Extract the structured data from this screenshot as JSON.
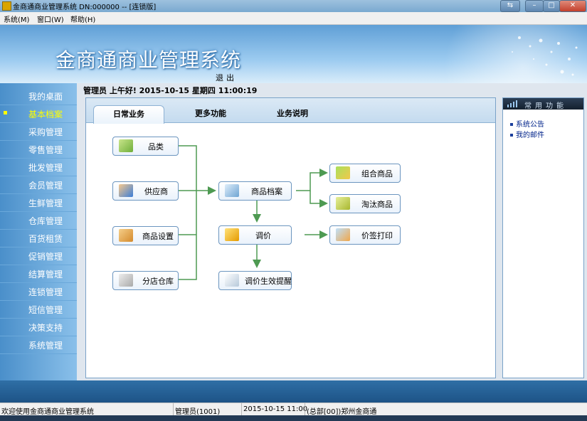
{
  "window": {
    "title": "金商通商业管理系统 DN:000000 -- [连锁版]",
    "controls": [
      "⇆",
      "–",
      "□",
      "✕"
    ]
  },
  "menu": [
    "系统(M)",
    "窗口(W)",
    "帮助(H)"
  ],
  "banner": {
    "app_title": "金商通商业管理系统",
    "logout": "退出"
  },
  "greeting": "管理员 上午好! 2015-10-15 星期四 11:00:19",
  "sidebar": {
    "active_index": 1,
    "items": [
      {
        "label": "我的桌面"
      },
      {
        "label": "基本档案"
      },
      {
        "label": "采购管理"
      },
      {
        "label": "零售管理"
      },
      {
        "label": "批发管理"
      },
      {
        "label": "会员管理"
      },
      {
        "label": "生鲜管理"
      },
      {
        "label": "仓库管理"
      },
      {
        "label": "百货租赁"
      },
      {
        "label": "促销管理"
      },
      {
        "label": "结算管理"
      },
      {
        "label": "连锁管理"
      },
      {
        "label": "短信管理"
      },
      {
        "label": "决策支持"
      },
      {
        "label": "系统管理"
      }
    ]
  },
  "tabs": [
    {
      "label": "日常业务",
      "active": true
    },
    {
      "label": "更多功能",
      "active": false
    },
    {
      "label": "业务说明",
      "active": false
    }
  ],
  "flow": {
    "category": {
      "label": "品类",
      "icon": "category-icon",
      "color": "#8bc34a"
    },
    "supplier": {
      "label": "供应商",
      "icon": "supplier-icon",
      "color": "#3b7dd8"
    },
    "product_settings": {
      "label": "商品设置",
      "icon": "box-icon",
      "color": "#e8a94a"
    },
    "branch_warehouse": {
      "label": "分店仓库",
      "icon": "warehouse-icon",
      "color": "#b9b9b9"
    },
    "product_archive": {
      "label": "商品档案",
      "icon": "archive-icon",
      "color": "#7fb0d8"
    },
    "price_adjust": {
      "label": "调价",
      "icon": "price-icon",
      "color": "#f2b600"
    },
    "price_reminder": {
      "label": "调价生效提醒",
      "icon": "reminder-icon",
      "color": "#c9d6e3"
    },
    "combo_product": {
      "label": "组合商品",
      "icon": "combo-icon",
      "color": "#7ec242"
    },
    "discontinued_product": {
      "label": "淘汰商品",
      "icon": "discontinued-icon",
      "color": "#c8d64a"
    },
    "label_print": {
      "label": "价签打印",
      "icon": "print-icon",
      "color": "#5aa3e0"
    },
    "connector_color": "#4e9a52"
  },
  "right_panel": {
    "header": "常用功能",
    "links": [
      "系统公告",
      "我的邮件"
    ]
  },
  "status": {
    "welcome": "欢迎使用金商通商业管理系统",
    "user": "管理员(1001)",
    "datetime": "2015-10-15 11:00",
    "store": "(总部[00])郑州金商通"
  }
}
